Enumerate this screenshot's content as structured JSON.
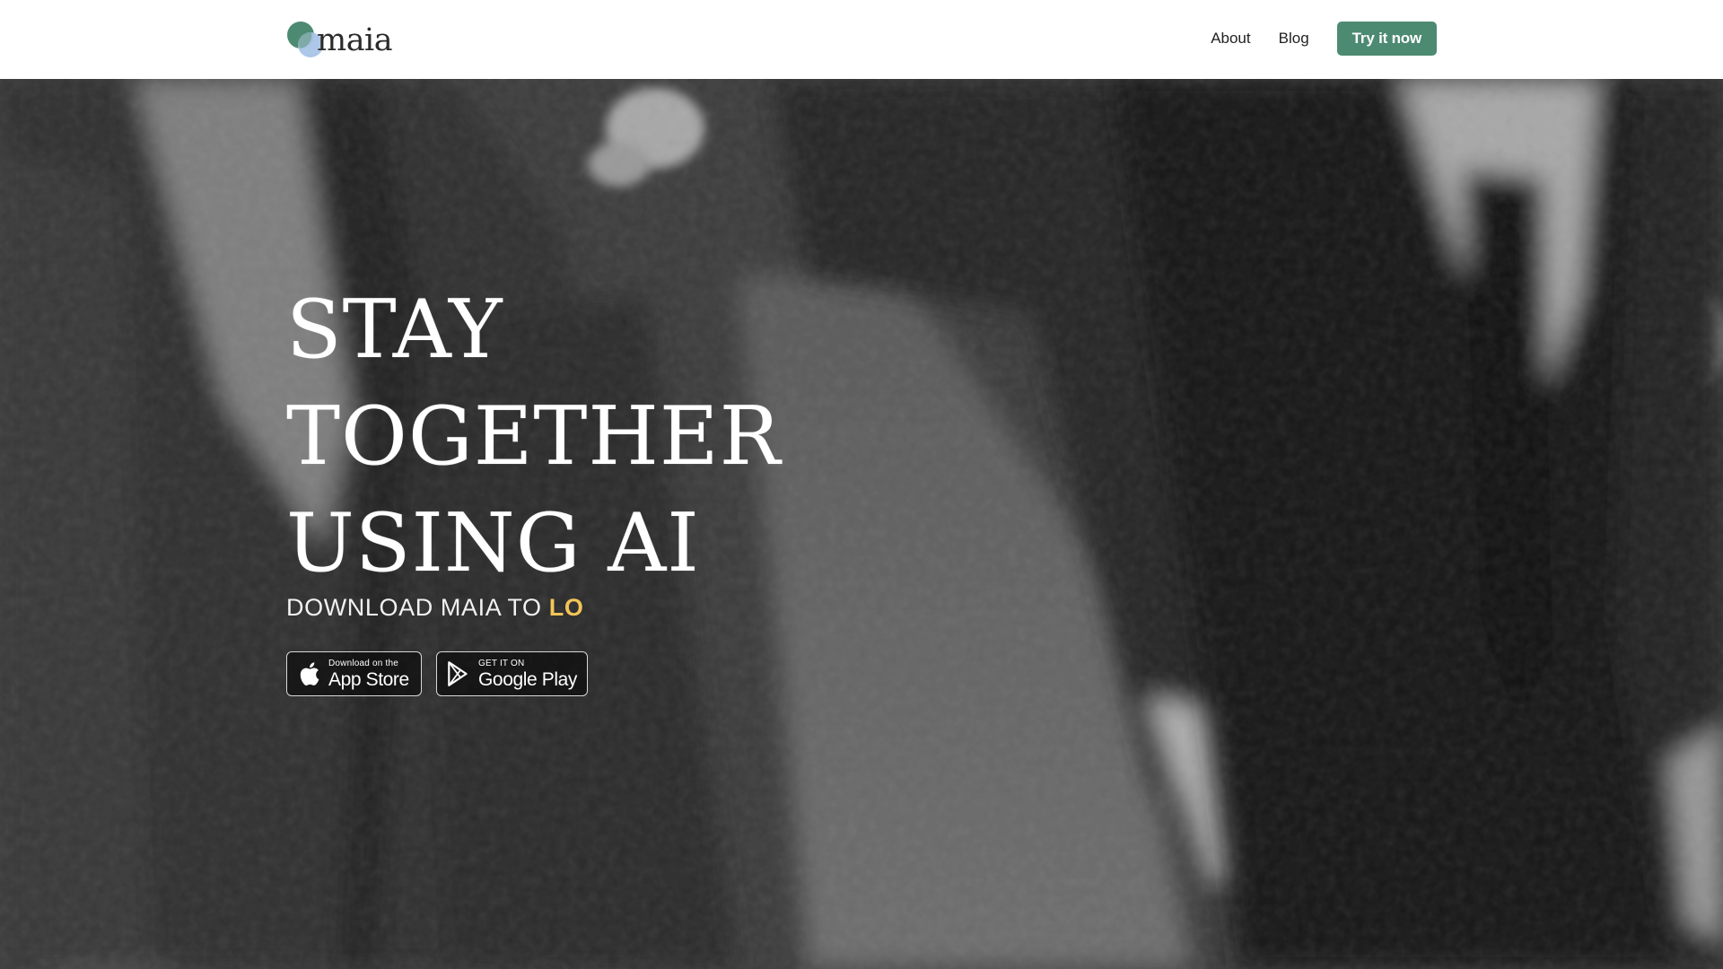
{
  "header": {
    "logo_text": "maia",
    "logo_colors": {
      "primary": "#4d8a72",
      "secondary": "#a9c4e8"
    },
    "nav": {
      "about": "About",
      "blog": "Blog",
      "cta": "Try it now"
    },
    "cta_color": "#4d8a72"
  },
  "hero": {
    "title_lines": [
      "STAY",
      "TOGETHER",
      "USING AI"
    ],
    "subtitle_prefix": "DOWNLOAD MAIA TO ",
    "subtitle_accent": "LO",
    "accent_color": "#f3c557",
    "badges": {
      "app_store": {
        "small": "Download on the",
        "big": "App Store",
        "icon": "apple-icon"
      },
      "google_play": {
        "small": "GET IT ON",
        "big": "Google Play",
        "icon": "google-play-icon"
      }
    }
  }
}
